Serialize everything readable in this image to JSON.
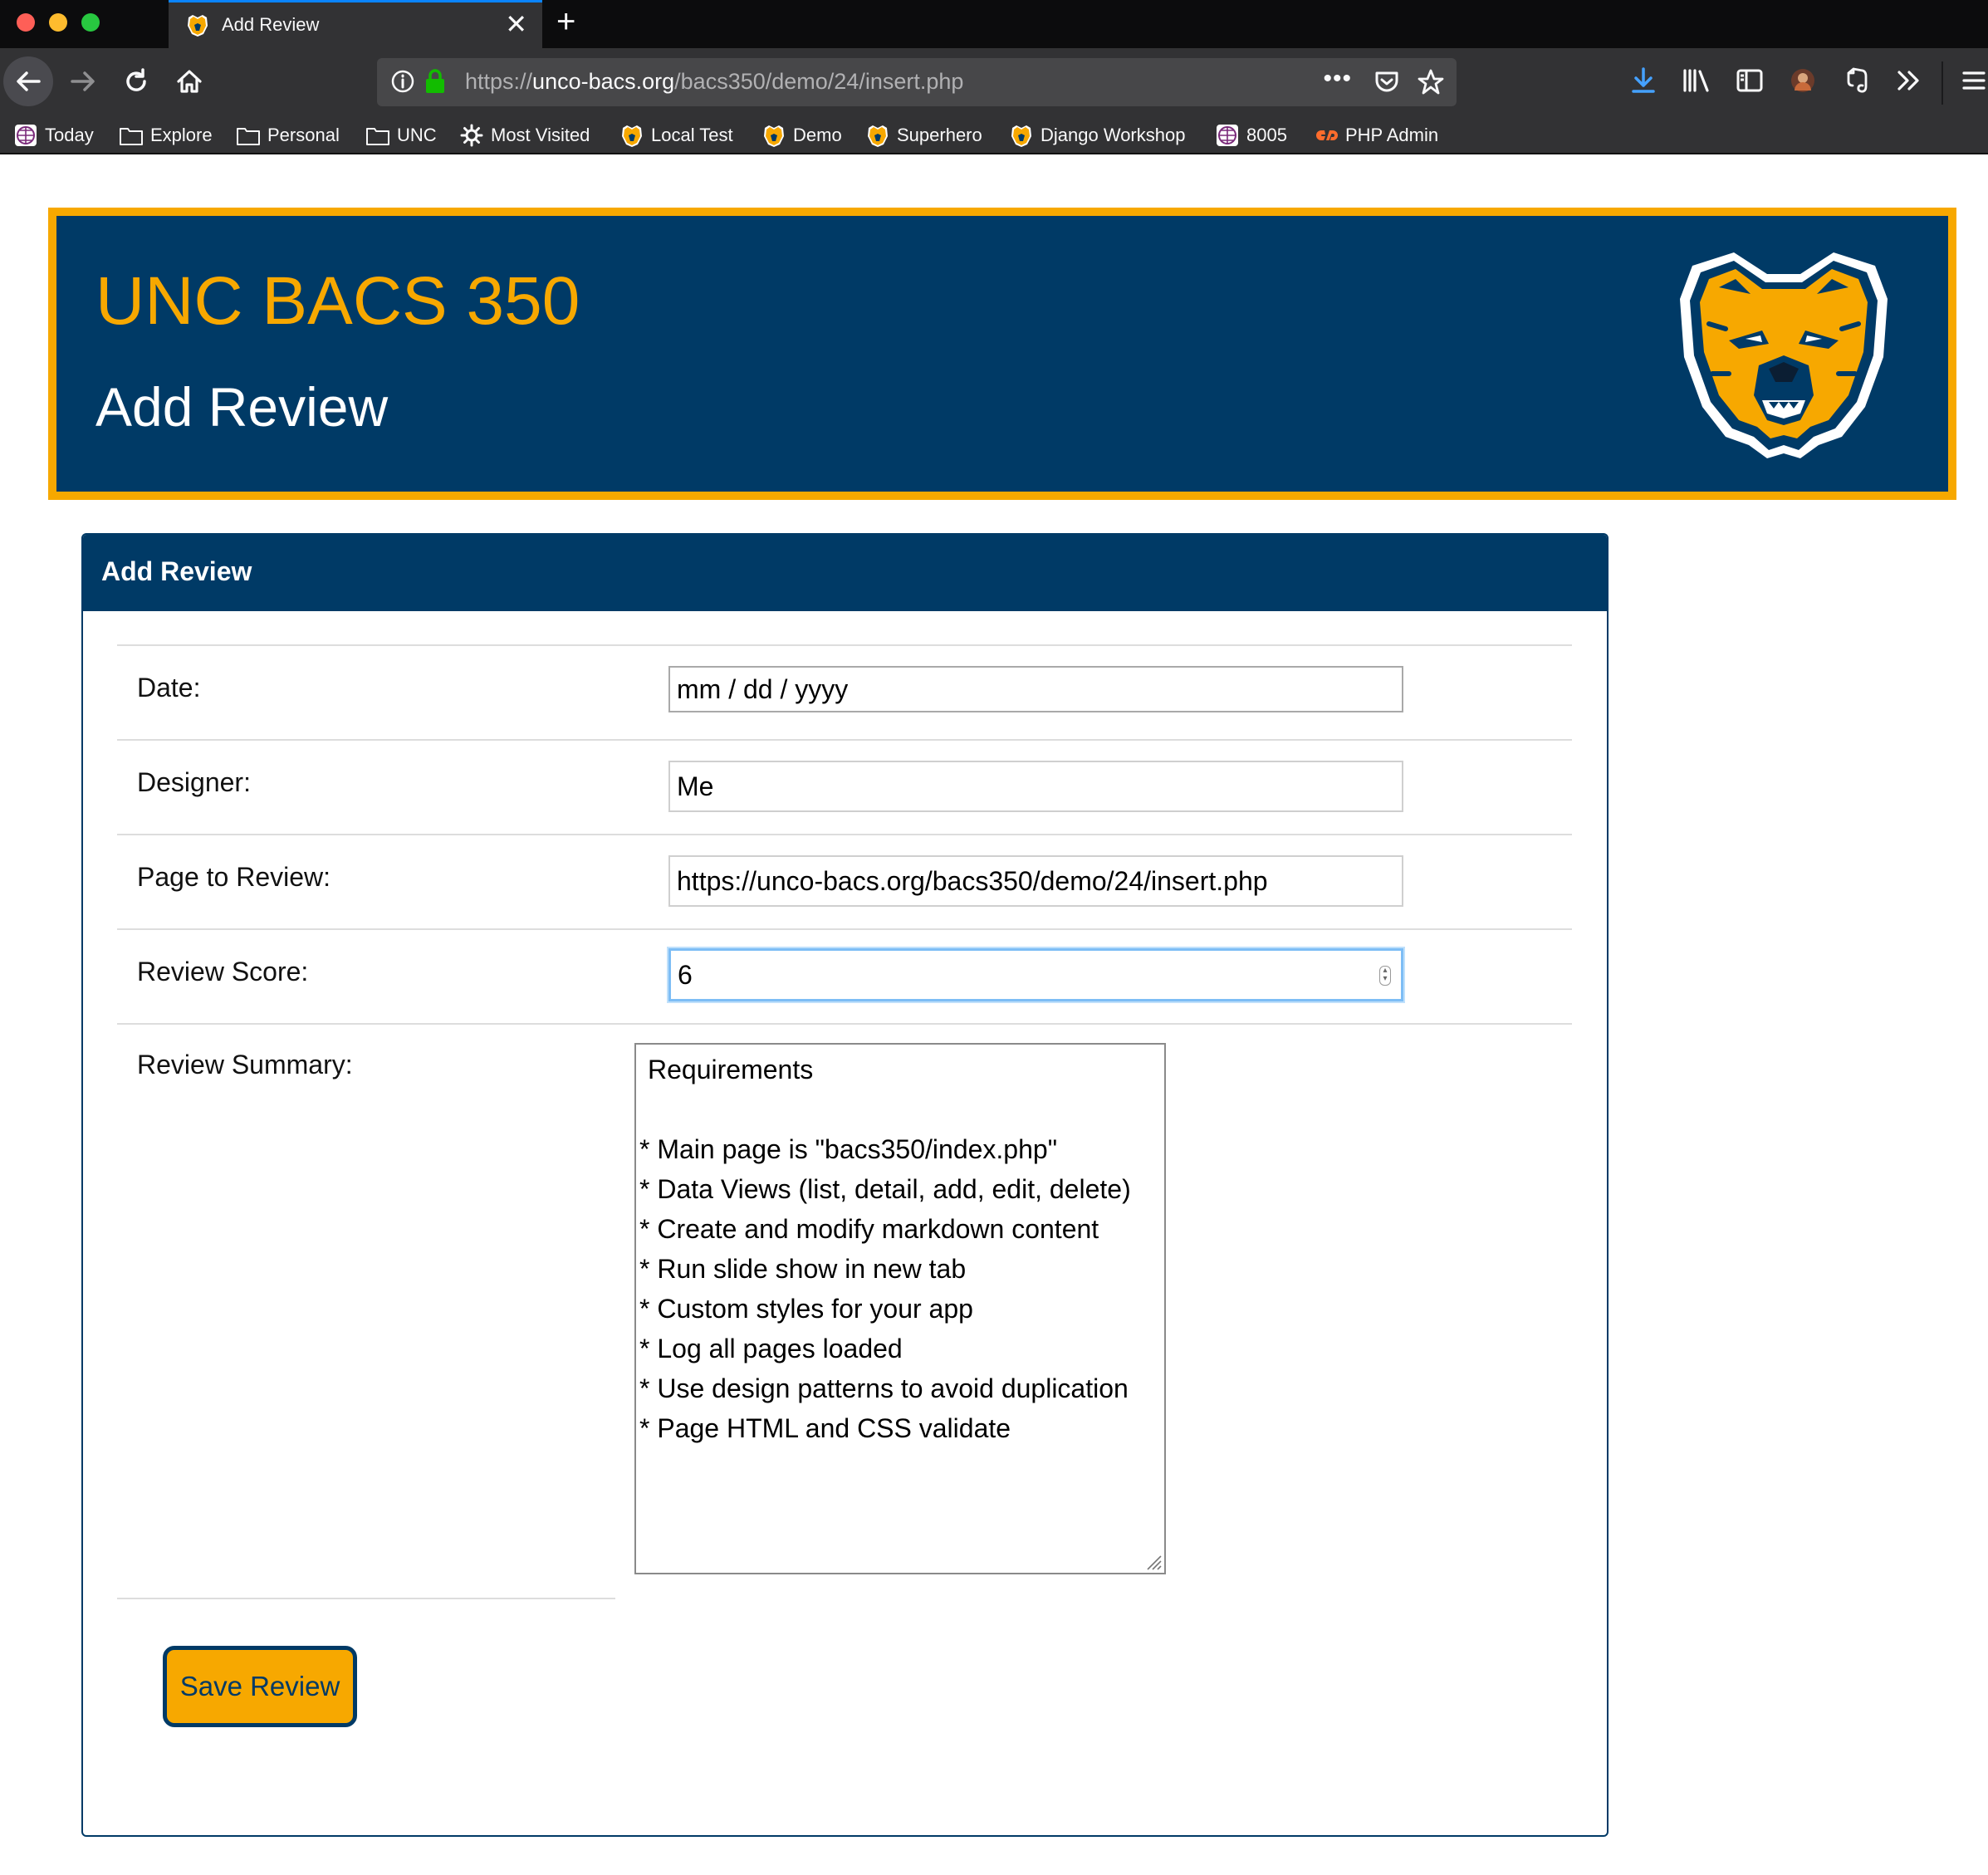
{
  "browser": {
    "tab": {
      "title": "Add Review",
      "close_glyph": "✕",
      "new_tab_glyph": "+"
    },
    "url": {
      "prefix": "https://",
      "domain": "unco-bacs.org",
      "path": "/bacs350/demo/24/insert.php",
      "more_glyph": "•••"
    },
    "bookmarks": [
      {
        "label": "Today",
        "icon": "globe-icon"
      },
      {
        "label": "Explore",
        "icon": "folder-icon"
      },
      {
        "label": "Personal",
        "icon": "folder-icon"
      },
      {
        "label": "UNC",
        "icon": "folder-icon"
      },
      {
        "label": "Most Visited",
        "icon": "gear-icon"
      },
      {
        "label": "Local Test",
        "icon": "bear-icon"
      },
      {
        "label": "Demo",
        "icon": "bear-icon"
      },
      {
        "label": "Superhero",
        "icon": "bear-icon"
      },
      {
        "label": "Django Workshop",
        "icon": "bear-icon"
      },
      {
        "label": "8005",
        "icon": "globe-icon"
      },
      {
        "label": "PHP Admin",
        "icon": "cpanel-icon"
      }
    ]
  },
  "banner": {
    "title": "UNC BACS 350",
    "subtitle": "Add Review"
  },
  "form": {
    "header": "Add Review",
    "fields": {
      "date": {
        "label": "Date:",
        "value": "mm / dd / yyyy"
      },
      "designer": {
        "label": "Designer:",
        "value": "Me"
      },
      "page": {
        "label": "Page to Review:",
        "value": "https://unco-bacs.org/bacs350/demo/24/insert.php"
      },
      "score": {
        "label": "Review Score:",
        "value": "6"
      },
      "summary": {
        "label": "Review Summary:",
        "lines": [
          "Requirements",
          "",
          "* Main page is \"bacs350/index.php\"",
          "* Data Views (list, detail, add, edit, delete)",
          "* Create and modify markdown content",
          "* Run slide show in new tab",
          "* Custom styles for your app",
          "* Log all pages loaded",
          "* Use design patterns to avoid duplication",
          "* Page HTML and CSS validate"
        ]
      }
    },
    "submit_label": "Save Review"
  },
  "colors": {
    "navy": "#003a66",
    "gold": "#f7a800",
    "focus": "#7dbdf5"
  }
}
